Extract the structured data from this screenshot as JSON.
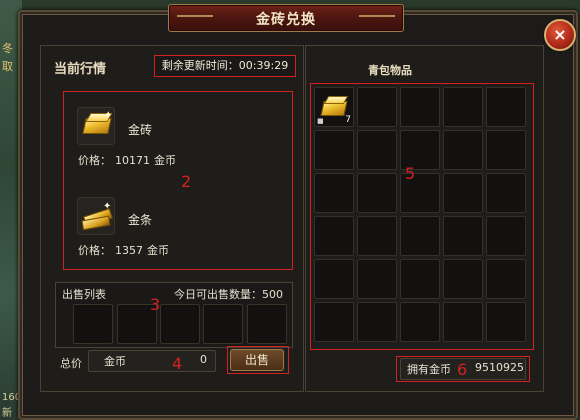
{
  "window": {
    "title": "金砖兑换",
    "close_glyph": "×"
  },
  "world": {
    "text_a": "冬",
    "text_b": "取",
    "text_c": "160",
    "text_d": "新"
  },
  "market": {
    "section_title": "当前行情",
    "timer": "剩余更新时间：00:39:29",
    "items": [
      {
        "name": "金砖",
        "icon": "gold-brick-icon",
        "price_label": "价格：",
        "price": "10171",
        "currency": "金币"
      },
      {
        "name": "金条",
        "icon": "gold-bar-icon",
        "price_label": "价格：",
        "price": "1357",
        "currency": "金币"
      }
    ]
  },
  "sell": {
    "list_title": "出售列表",
    "quota_label": "今日可出售数量：500",
    "total_label": "总价",
    "total_currency": "金币",
    "total_value": "0",
    "sell_button": "出售"
  },
  "bag": {
    "title": "青包物品",
    "items": [
      {
        "icon": "gold-brick-icon",
        "count": "7",
        "locked": true
      }
    ],
    "owned_label": "拥有金币",
    "owned_value": "9510925"
  },
  "annotations": [
    "2",
    "3",
    "4",
    "5",
    "6"
  ],
  "colors": {
    "annotation_red": "#d42020",
    "title_plate": "#6e2218",
    "panel_bg": "#1e1d1a"
  }
}
